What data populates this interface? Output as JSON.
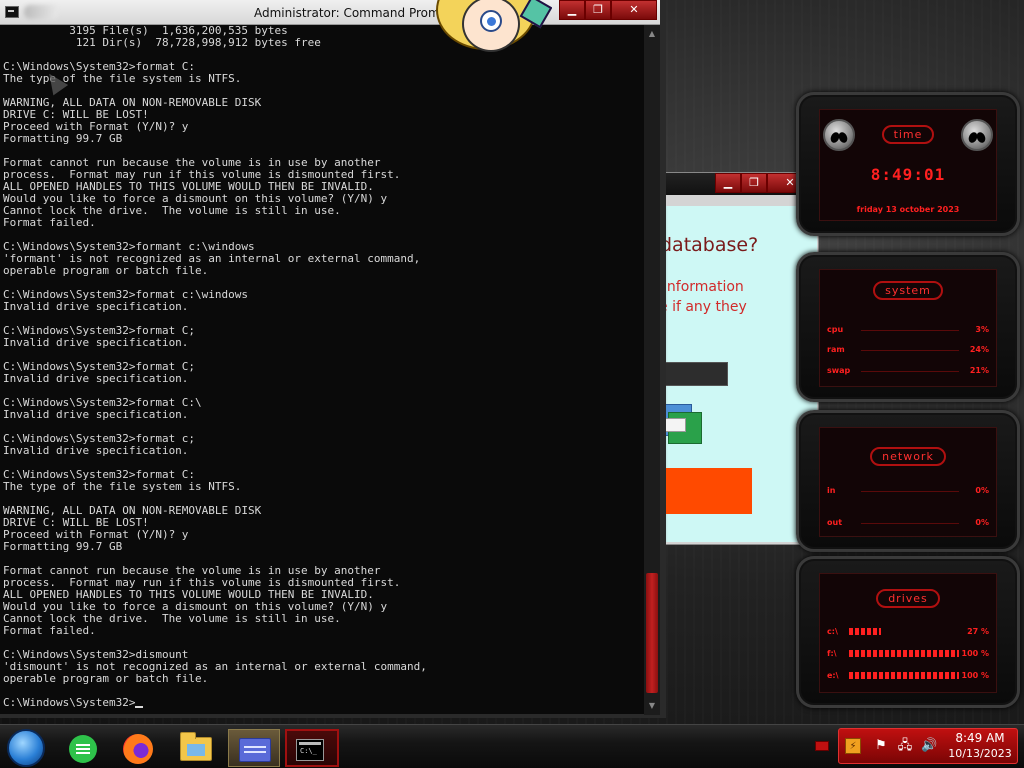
{
  "cmd": {
    "title": "Administrator: Command Prompt",
    "buttons": {
      "minimize": "▁",
      "maximize": "❐",
      "close": "✕"
    },
    "lines": [
      "          3195 File(s)  1,636,200,535 bytes",
      "           121 Dir(s)  78,728,998,912 bytes free",
      "",
      "C:\\Windows\\System32>format C:",
      "The type of the file system is NTFS.",
      "",
      "WARNING, ALL DATA ON NON-REMOVABLE DISK",
      "DRIVE C: WILL BE LOST!",
      "Proceed with Format (Y/N)? y",
      "Formatting 99.7 GB",
      "",
      "Format cannot run because the volume is in use by another",
      "process.  Format may run if this volume is dismounted first.",
      "ALL OPENED HANDLES TO THIS VOLUME WOULD THEN BE INVALID.",
      "Would you like to force a dismount on this volume? (Y/N) y",
      "Cannot lock the drive.  The volume is still in use.",
      "Format failed.",
      "",
      "C:\\Windows\\System32>formant c:\\windows",
      "'formant' is not recognized as an internal or external command,",
      "operable program or batch file.",
      "",
      "C:\\Windows\\System32>format c:\\windows",
      "Invalid drive specification.",
      "",
      "C:\\Windows\\System32>format C;",
      "Invalid drive specification.",
      "",
      "C:\\Windows\\System32>format C;",
      "Invalid drive specification.",
      "",
      "C:\\Windows\\System32>format C:\\",
      "Invalid drive specification.",
      "",
      "C:\\Windows\\System32>format c;",
      "Invalid drive specification.",
      "",
      "C:\\Windows\\System32>format C:",
      "The type of the file system is NTFS.",
      "",
      "WARNING, ALL DATA ON NON-REMOVABLE DISK",
      "DRIVE C: WILL BE LOST!",
      "Proceed with Format (Y/N)? y",
      "Formatting 99.7 GB",
      "",
      "Format cannot run because the volume is in use by another",
      "process.  Format may run if this volume is dismounted first.",
      "ALL OPENED HANDLES TO THIS VOLUME WOULD THEN BE INVALID.",
      "Would you like to force a dismount on this volume? (Y/N) y",
      "Cannot lock the drive.  The volume is still in use.",
      "Format failed.",
      "",
      "C:\\Windows\\System32>dismount",
      "'dismount' is not recognized as an internal or external command,",
      "operable program or batch file.",
      ""
    ],
    "prompt": "C:\\Windows\\System32>"
  },
  "app_window": {
    "buttons": {
      "minimize": "▁",
      "maximize": "❐",
      "close": "✕"
    },
    "heading": "database?",
    "text1": "information",
    "text2": "e if any they"
  },
  "gadgets": {
    "time": {
      "title": "time",
      "clock": "8:49:01",
      "date": "friday 13 october 2023"
    },
    "system": {
      "title": "system",
      "rows": [
        {
          "label": "cpu",
          "value": "3%"
        },
        {
          "label": "ram",
          "value": "24%"
        },
        {
          "label": "swap",
          "value": "21%"
        }
      ]
    },
    "network": {
      "title": "network",
      "rows": [
        {
          "label": "in",
          "value": "0%"
        },
        {
          "label": "out",
          "value": "0%"
        }
      ]
    },
    "drives": {
      "title": "drives",
      "rows": [
        {
          "label": "c:\\",
          "value": "27 %",
          "fill": 0.27
        },
        {
          "label": "f:\\",
          "value": "100 %",
          "fill": 1.0
        },
        {
          "label": "e:\\",
          "value": "100 %",
          "fill": 1.0
        }
      ]
    }
  },
  "taskbar": {
    "apps": [
      "start-orb",
      "notes-icon",
      "firefox-icon",
      "file-explorer-icon",
      "app-icon",
      "command-prompt-icon"
    ],
    "cmd_icon_text": "C:\\_",
    "tray": {
      "time": "8:49 AM",
      "date": "10/13/2023"
    }
  },
  "colors": {
    "accent_red": "#ff2020",
    "taskbar_tray": "#c01010",
    "app_button": "#ff4a00"
  }
}
